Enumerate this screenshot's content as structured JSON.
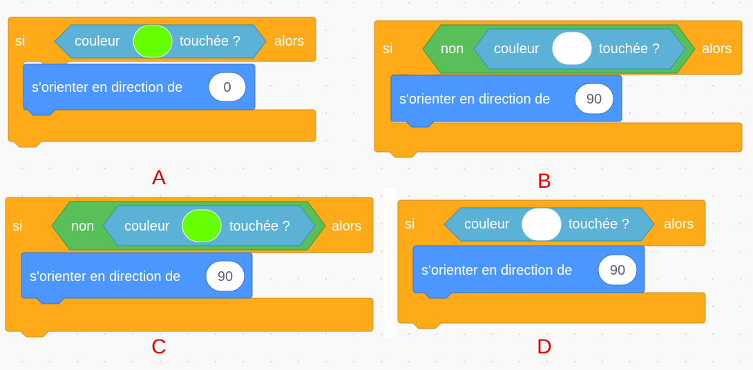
{
  "blocks": [
    {
      "id": "A",
      "if_label": "si",
      "then_label": "alors",
      "negated": false,
      "sensor_pre": "couleur",
      "sensor_post": "touchée ?",
      "swatch_color": "#66ff00",
      "motion_label": "s'orienter en direction de",
      "direction_value": "0",
      "caption": "A"
    },
    {
      "id": "B",
      "if_label": "si",
      "then_label": "alors",
      "negated": true,
      "not_label": "non",
      "sensor_pre": "couleur",
      "sensor_post": "touchée ?",
      "swatch_color": "#ffffff",
      "motion_label": "s'orienter en direction de",
      "direction_value": "90",
      "caption": "B"
    },
    {
      "id": "C",
      "if_label": "si",
      "then_label": "alors",
      "negated": true,
      "not_label": "non",
      "sensor_pre": "couleur",
      "sensor_post": "touchée ?",
      "swatch_color": "#66ff00",
      "motion_label": "s'orienter en direction de",
      "direction_value": "90",
      "caption": "C"
    },
    {
      "id": "D",
      "if_label": "si",
      "then_label": "alors",
      "negated": false,
      "sensor_pre": "couleur",
      "sensor_post": "touchée ?",
      "swatch_color": "#ffffff",
      "motion_label": "s'orienter en direction de",
      "direction_value": "90",
      "caption": "D"
    }
  ],
  "colors": {
    "control": "#ffab19",
    "control_border": "#cf8b17",
    "operator": "#59c059",
    "operator_border": "#389438",
    "sensing": "#5cb1d6",
    "sensing_border": "#2e8eb8",
    "motion": "#4c97ff",
    "motion_border": "#3373cc"
  }
}
